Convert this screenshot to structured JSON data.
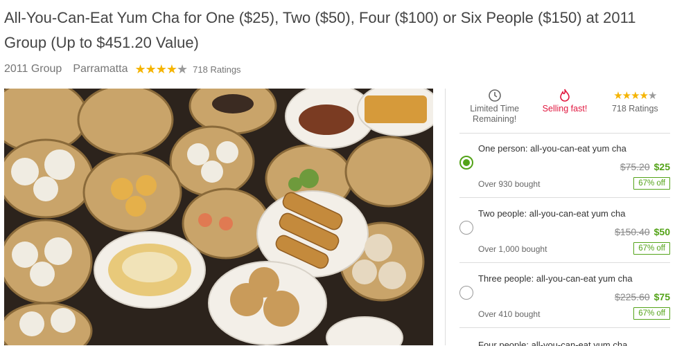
{
  "deal": {
    "title": "All-You-Can-Eat Yum Cha for One ($25), Two ($50), Four ($100) or Six People ($150) at 2011 Group (Up to $451.20 Value)",
    "merchant": "2011 Group",
    "location": "Parramatta",
    "rating_stars": 4,
    "ratings_text": "718 Ratings"
  },
  "image": {
    "alt": "Yum cha dishes"
  },
  "badges": {
    "limited": "Limited Time Remaining!",
    "selling": "Selling fast!",
    "ratings": "718 Ratings"
  },
  "options": [
    {
      "name": "One person: all-you-can-eat yum cha",
      "old_price": "$75.20",
      "new_price": "$25",
      "bought": "Over 930 bought",
      "discount": "67% off",
      "selected": true
    },
    {
      "name": "Two people: all-you-can-eat yum cha",
      "old_price": "$150.40",
      "new_price": "$50",
      "bought": "Over 1,000 bought",
      "discount": "67% off",
      "selected": false
    },
    {
      "name": "Three people: all-you-can-eat yum cha",
      "old_price": "$225.60",
      "new_price": "$75",
      "bought": "Over 410 bought",
      "discount": "67% off",
      "selected": false
    },
    {
      "name": "Four people: all-you-can-eat yum cha"
    }
  ],
  "colors": {
    "accent_green": "#53a318",
    "selling_red": "#e1173f",
    "star_gold": "#f5b400"
  },
  "icons": {
    "limited": "clock-icon",
    "selling": "flame-icon"
  }
}
